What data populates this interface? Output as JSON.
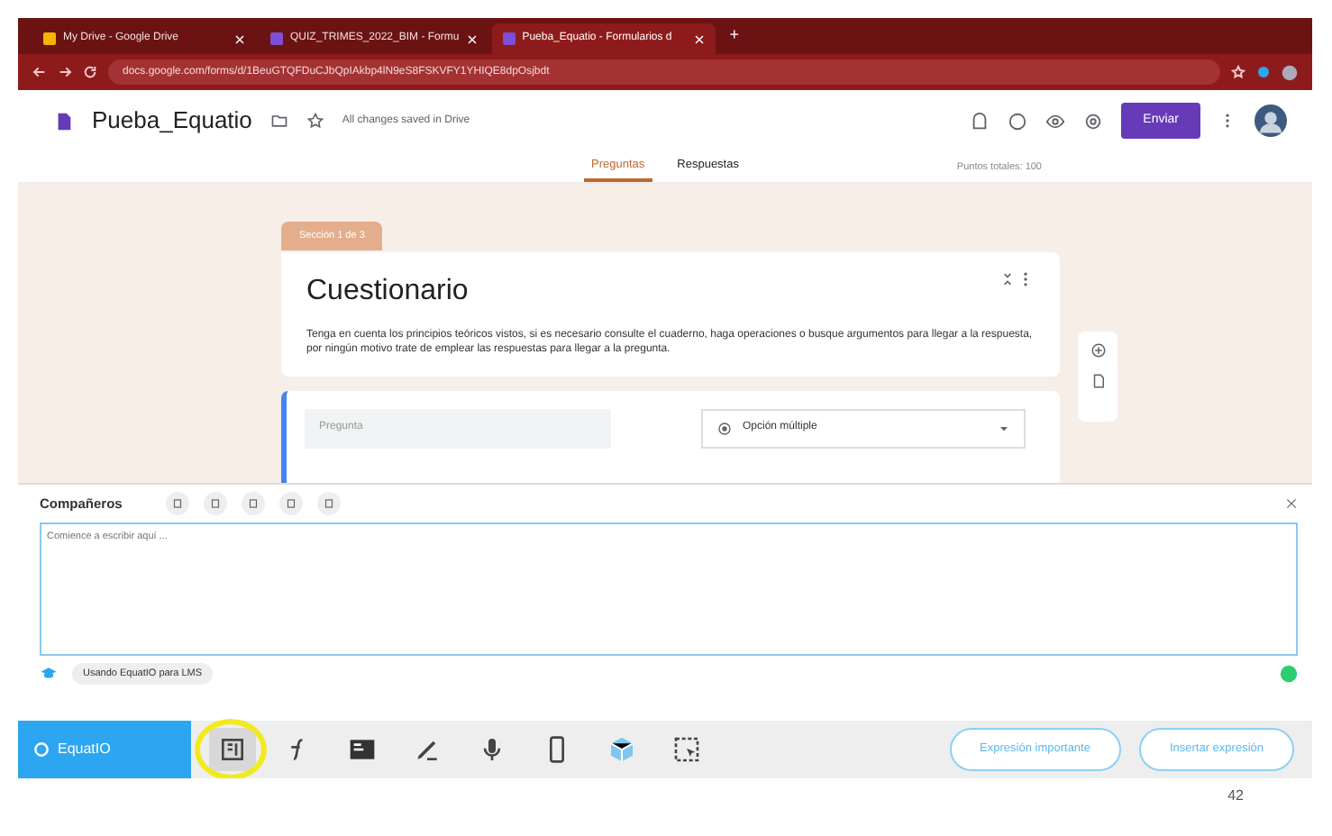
{
  "browser": {
    "tabs": [
      {
        "title": "My Drive - Google Drive",
        "selected": false
      },
      {
        "title": "QUIZ_TRIMES_2022_BIM - Formu",
        "selected": false
      },
      {
        "title": "Pueba_Equatio - Formularios d",
        "selected": true
      }
    ],
    "new_tab": "+",
    "url": "docs.google.com/forms/d/1BeuGTQFDuCJbQpIAkbp4lN9eS8FSKVFY1YHIQE8dpOsjbdt"
  },
  "form_header": {
    "title": "Pueba_Equatio",
    "save_status": "All changes saved in Drive",
    "send_button": "Enviar",
    "tabs": [
      {
        "label": "Preguntas",
        "selected": true
      },
      {
        "label": "Respuestas",
        "selected": false
      }
    ],
    "total_points": "Puntos totales: 100"
  },
  "section_badge": "Sección 1 de 3",
  "form_card": {
    "title": "Cuestionario",
    "description": "Tenga en cuenta los principios teóricos vistos, si es necesario consulte el cuaderno, haga operaciones o busque argumentos para llegar a la respuesta, por ningún motivo trate de emplear las respuestas para llegar a la pregunta."
  },
  "question": {
    "placeholder": "Pregunta",
    "type": "Opción múltiple"
  },
  "equatio": {
    "title": "Compañeros",
    "editor_placeholder": "Comience a escribir aquí ...",
    "lms_chip": "Usando EquatIO para LMS",
    "brand_button": "EquatIO",
    "tools": [
      {
        "kind": "math",
        "highlighted": true
      },
      {
        "kind": "function",
        "highlighted": false
      },
      {
        "kind": "latex",
        "highlighted": false
      },
      {
        "kind": "handwriting",
        "highlighted": false
      },
      {
        "kind": "speech",
        "highlighted": false
      },
      {
        "kind": "mobile",
        "highlighted": false
      },
      {
        "kind": "cube",
        "highlighted": false
      },
      {
        "kind": "screenshot",
        "highlighted": false
      }
    ],
    "buttons": [
      "Expresión importante",
      "Insertar expresión"
    ]
  },
  "page_number": "42"
}
